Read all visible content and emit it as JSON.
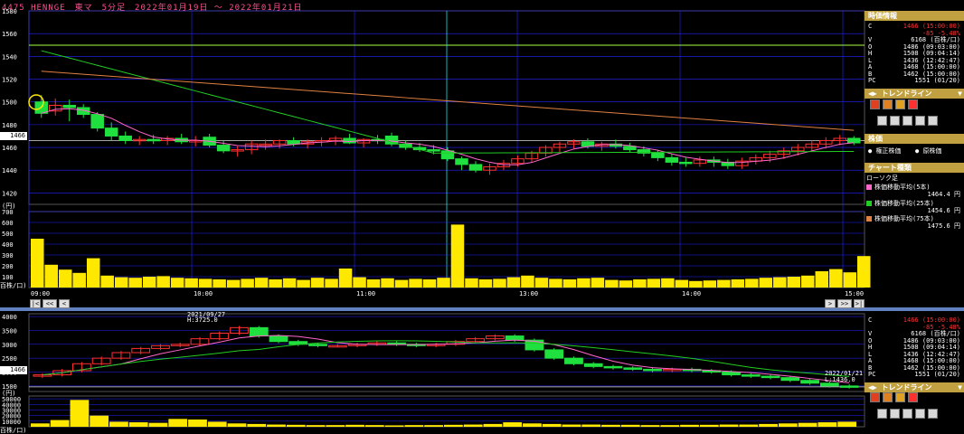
{
  "title": "4475 HENNGE　東マ　5分足　2022年01月19日 ～ 2022年01月21日",
  "colors": {
    "up": "#ff3030",
    "down": "#20e040",
    "ma5": "#ff66cc",
    "ma25": "#22cc22",
    "ma75": "#e08040",
    "vol": "#ffe800",
    "grid": "#2323ff",
    "cursor": "#20e0e0",
    "hline": "#aaff44"
  },
  "top_chart": {
    "price_ticks": [
      "1580",
      "1560",
      "1540",
      "1520",
      "1500",
      "1480",
      "1460",
      "1440",
      "1420"
    ],
    "current_price_tag": "1466",
    "volume_unit": "(円)",
    "volume_ticks": [
      "700",
      "600",
      "500",
      "400",
      "300",
      "200",
      "100"
    ],
    "volume_bottom_label": "百株/口)",
    "time_labels": [
      "09:00",
      "10:00",
      "11:00",
      "13:00",
      "14:00",
      "15:00"
    ],
    "nav_left": [
      "|<",
      "<<",
      "<"
    ],
    "nav_right": [
      ">",
      ">>",
      ">|"
    ]
  },
  "bottom_chart": {
    "ticks": [
      "4000",
      "3500",
      "3000",
      "2500",
      "2000",
      "1500"
    ],
    "current_price_tag": "1466",
    "high_annotation_date": "2021/09/27",
    "high_annotation": "H:3725.0",
    "low_annotation_date": "2022/01/21",
    "low_annotation": "L:1436.0",
    "volume_unit": "(円)",
    "volume_ticks": [
      "50000",
      "40000",
      "30000",
      "20000",
      "10000"
    ],
    "volume_bottom_label": "百株/口)"
  },
  "chart_data": [
    {
      "type": "candlestick",
      "title": "4475 HENNGE 東マ 5分足 2022年01月19日 ～ 2022年01月21日",
      "ylim": [
        1410,
        1580
      ],
      "candles": [
        {
          "o": 1500,
          "h": 1506,
          "l": 1486,
          "c": 1490
        },
        {
          "o": 1492,
          "h": 1503,
          "l": 1488,
          "c": 1497
        },
        {
          "o": 1497,
          "h": 1502,
          "l": 1483,
          "c": 1495
        },
        {
          "o": 1495,
          "h": 1498,
          "l": 1486,
          "c": 1489
        },
        {
          "o": 1489,
          "h": 1491,
          "l": 1474,
          "c": 1477
        },
        {
          "o": 1477,
          "h": 1482,
          "l": 1466,
          "c": 1470
        },
        {
          "o": 1470,
          "h": 1474,
          "l": 1463,
          "c": 1466
        },
        {
          "o": 1466,
          "h": 1470,
          "l": 1462,
          "c": 1467
        },
        {
          "o": 1467,
          "h": 1471,
          "l": 1463,
          "c": 1466
        },
        {
          "o": 1466,
          "h": 1470,
          "l": 1462,
          "c": 1468
        },
        {
          "o": 1468,
          "h": 1472,
          "l": 1463,
          "c": 1465
        },
        {
          "o": 1465,
          "h": 1470,
          "l": 1461,
          "c": 1466
        },
        {
          "o": 1469,
          "h": 1472,
          "l": 1460,
          "c": 1462
        },
        {
          "o": 1462,
          "h": 1466,
          "l": 1455,
          "c": 1457
        },
        {
          "o": 1457,
          "h": 1461,
          "l": 1452,
          "c": 1458
        },
        {
          "o": 1458,
          "h": 1466,
          "l": 1454,
          "c": 1463
        },
        {
          "o": 1463,
          "h": 1467,
          "l": 1458,
          "c": 1463
        },
        {
          "o": 1463,
          "h": 1467,
          "l": 1459,
          "c": 1466
        },
        {
          "o": 1466,
          "h": 1469,
          "l": 1461,
          "c": 1463
        },
        {
          "o": 1463,
          "h": 1467,
          "l": 1459,
          "c": 1465
        },
        {
          "o": 1465,
          "h": 1469,
          "l": 1461,
          "c": 1466
        },
        {
          "o": 1466,
          "h": 1470,
          "l": 1462,
          "c": 1468
        },
        {
          "o": 1468,
          "h": 1472,
          "l": 1463,
          "c": 1464
        },
        {
          "o": 1464,
          "h": 1468,
          "l": 1460,
          "c": 1467
        },
        {
          "o": 1467,
          "h": 1471,
          "l": 1463,
          "c": 1466
        },
        {
          "o": 1470,
          "h": 1473,
          "l": 1461,
          "c": 1463
        },
        {
          "o": 1463,
          "h": 1466,
          "l": 1458,
          "c": 1460
        },
        {
          "o": 1460,
          "h": 1464,
          "l": 1456,
          "c": 1458
        },
        {
          "o": 1458,
          "h": 1462,
          "l": 1454,
          "c": 1457
        },
        {
          "o": 1457,
          "h": 1460,
          "l": 1448,
          "c": 1450
        },
        {
          "o": 1450,
          "h": 1452,
          "l": 1440,
          "c": 1445
        },
        {
          "o": 1445,
          "h": 1448,
          "l": 1438,
          "c": 1440
        },
        {
          "o": 1440,
          "h": 1446,
          "l": 1436,
          "c": 1443
        },
        {
          "o": 1443,
          "h": 1449,
          "l": 1440,
          "c": 1446
        },
        {
          "o": 1446,
          "h": 1453,
          "l": 1443,
          "c": 1450
        },
        {
          "o": 1450,
          "h": 1457,
          "l": 1447,
          "c": 1455
        },
        {
          "o": 1455,
          "h": 1462,
          "l": 1452,
          "c": 1460
        },
        {
          "o": 1460,
          "h": 1465,
          "l": 1456,
          "c": 1463
        },
        {
          "o": 1463,
          "h": 1467,
          "l": 1459,
          "c": 1465
        },
        {
          "o": 1465,
          "h": 1468,
          "l": 1459,
          "c": 1461
        },
        {
          "o": 1461,
          "h": 1465,
          "l": 1457,
          "c": 1463
        },
        {
          "o": 1463,
          "h": 1467,
          "l": 1459,
          "c": 1461
        },
        {
          "o": 1461,
          "h": 1464,
          "l": 1456,
          "c": 1458
        },
        {
          "o": 1458,
          "h": 1461,
          "l": 1452,
          "c": 1455
        },
        {
          "o": 1455,
          "h": 1458,
          "l": 1448,
          "c": 1451
        },
        {
          "o": 1451,
          "h": 1454,
          "l": 1444,
          "c": 1447
        },
        {
          "o": 1447,
          "h": 1451,
          "l": 1443,
          "c": 1446
        },
        {
          "o": 1446,
          "h": 1452,
          "l": 1443,
          "c": 1449
        },
        {
          "o": 1449,
          "h": 1452,
          "l": 1443,
          "c": 1447
        },
        {
          "o": 1447,
          "h": 1450,
          "l": 1441,
          "c": 1444
        },
        {
          "o": 1444,
          "h": 1451,
          "l": 1441,
          "c": 1448
        },
        {
          "o": 1448,
          "h": 1454,
          "l": 1445,
          "c": 1451
        },
        {
          "o": 1451,
          "h": 1457,
          "l": 1447,
          "c": 1454
        },
        {
          "o": 1454,
          "h": 1460,
          "l": 1450,
          "c": 1457
        },
        {
          "o": 1457,
          "h": 1463,
          "l": 1453,
          "c": 1460
        },
        {
          "o": 1460,
          "h": 1466,
          "l": 1456,
          "c": 1463
        },
        {
          "o": 1463,
          "h": 1469,
          "l": 1459,
          "c": 1466
        },
        {
          "o": 1466,
          "h": 1471,
          "l": 1462,
          "c": 1468
        },
        {
          "o": 1468,
          "h": 1470,
          "l": 1462,
          "c": 1464
        }
      ],
      "ma5_label": "株価移動平均(5本)",
      "ma5_value": "1464.4 円",
      "ma25_label": "株価移動平均(25本)",
      "ma25_value": "1454.6 円",
      "ma75_label": "株価移動平均(75本)",
      "ma75_value": "1475.6 円",
      "volume": [
        450,
        210,
        165,
        135,
        270,
        110,
        95,
        90,
        100,
        105,
        90,
        85,
        80,
        75,
        70,
        80,
        90,
        75,
        85,
        70,
        90,
        80,
        175,
        95,
        75,
        85,
        70,
        80,
        75,
        90,
        580,
        85,
        75,
        80,
        95,
        110,
        90,
        80,
        75,
        85,
        90,
        70,
        65,
        75,
        80,
        85,
        70,
        60,
        65,
        70,
        75,
        80,
        90,
        95,
        100,
        110,
        150,
        170,
        140,
        290
      ]
    },
    {
      "type": "candlestick",
      "title": "",
      "ylim": [
        1300,
        4100
      ],
      "candles_close": [
        1900,
        2050,
        2300,
        2500,
        2700,
        2850,
        2950,
        3000,
        3200,
        3400,
        3600,
        3300,
        3100,
        3000,
        2950,
        2950,
        3000,
        3050,
        3000,
        2950,
        3000,
        3100,
        3200,
        3300,
        3150,
        2800,
        2500,
        2300,
        2200,
        2150,
        2100,
        2050,
        2100,
        2050,
        2000,
        1900,
        1850,
        1800,
        1700,
        1600,
        1500,
        1466
      ],
      "volume": [
        6000,
        12000,
        48000,
        20000,
        9000,
        8000,
        7000,
        14000,
        13000,
        9000,
        6000,
        5000,
        4000,
        3500,
        3000,
        3000,
        3500,
        3000,
        2500,
        3000,
        3000,
        3500,
        4000,
        5000,
        8000,
        6000,
        5000,
        4000,
        4000,
        3500,
        3500,
        3000,
        3000,
        3500,
        3500,
        4000,
        4000,
        5000,
        6000,
        7000,
        8000,
        9000
      ]
    }
  ],
  "right_panel": {
    "info_header": "時価情報",
    "info_rows": [
      {
        "k": "C",
        "v": "1466 (15:00:00)"
      },
      {
        "k": "",
        "v": "-85 -5.48%"
      },
      {
        "k": "V",
        "v": "6168 (百株/口)"
      },
      {
        "k": "O",
        "v": "1486 (09:03:00)"
      },
      {
        "k": "H",
        "v": "1508 (09:04:14)"
      },
      {
        "k": "L",
        "v": "1436 (12:42:47)"
      },
      {
        "k": "A",
        "v": "1468 (15:00:00)"
      },
      {
        "k": "B",
        "v": "1462 (15:00:00)"
      },
      {
        "k": "PC",
        "v": "1551 (01/20)"
      }
    ],
    "trendline_label": "トレンドライン",
    "kabuka_header": "株価",
    "radio_fixed": "権正株価",
    "radio_raw": "原株価",
    "chart_type_header": "チャート種類",
    "chart_type_value": "ローソク足"
  },
  "right_panel_bottom": {
    "info_rows": [
      {
        "k": "C",
        "v": "1466 (15:00:00)"
      },
      {
        "k": "",
        "v": "-85 -5.48%"
      },
      {
        "k": "V",
        "v": "6168 (百株/口)"
      },
      {
        "k": "O",
        "v": "1486 (09:03:00)"
      },
      {
        "k": "H",
        "v": "1508 (09:04:14)"
      },
      {
        "k": "L",
        "v": "1436 (12:42:47)"
      },
      {
        "k": "A",
        "v": "1468 (15:00:00)"
      },
      {
        "k": "B",
        "v": "1462 (15:00:00)"
      },
      {
        "k": "PC",
        "v": "1551 (01/20)"
      }
    ],
    "trendline_label": "トレンドライン"
  }
}
